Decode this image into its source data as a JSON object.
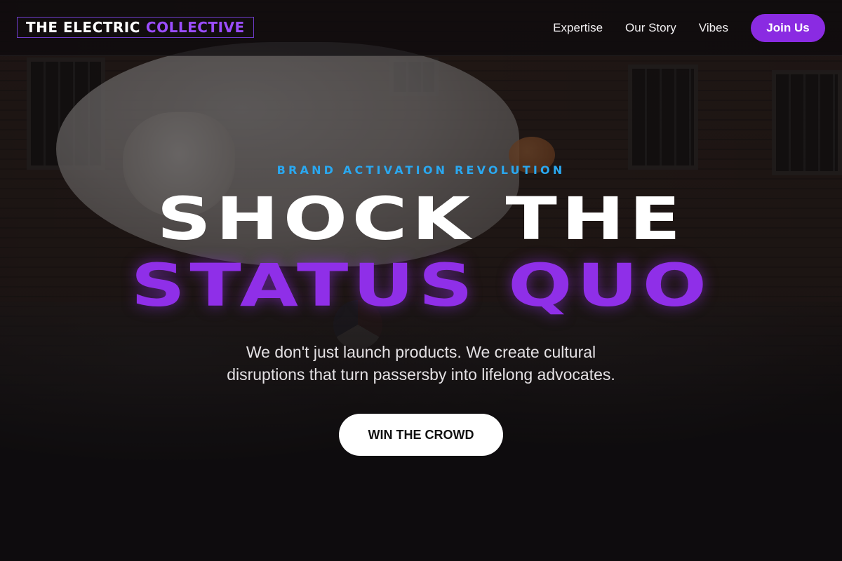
{
  "nav": {
    "logo": {
      "part1": "THE ELECTRIC",
      "part2": "COLLECTIVE"
    },
    "links": [
      "Expertise",
      "Our Story",
      "Vibes"
    ],
    "join_label": "Join Us"
  },
  "hero": {
    "eyebrow": "BRAND ACTIVATION REVOLUTION",
    "headline_line1": "SHOCK THE",
    "headline_line2": "STATUS QUO",
    "subtext_line1": "We don't just launch products. We create cultural",
    "subtext_line2": "disruptions that turn passersby into lifelong advocates.",
    "cta_label": "WIN THE CROWD"
  },
  "colors": {
    "accent_purple": "#8a2be2",
    "eyebrow_blue": "#2aa8f0",
    "background": "#141113"
  }
}
